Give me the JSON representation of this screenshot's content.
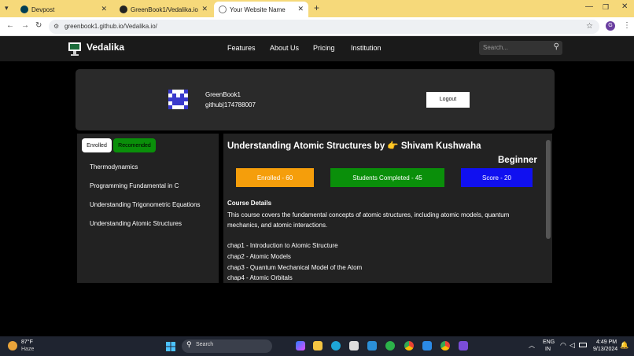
{
  "browser": {
    "tabs": [
      {
        "title": "Devpost"
      },
      {
        "title": "GreenBook1/Vedalika.io"
      },
      {
        "title": "Your Website Name"
      }
    ],
    "url": "greenbook1.github.io/Vedalika.io/",
    "profile_initial": "G"
  },
  "nav": {
    "brand": "Vedalika",
    "links": [
      "Features",
      "About Us",
      "Pricing",
      "Institution"
    ],
    "search_placeholder": "Search..."
  },
  "profile": {
    "name": "GreenBook1",
    "id": "github|174788007",
    "logout_label": "Logout"
  },
  "sidebar": {
    "tabs": [
      "Enrolled",
      "Recomended"
    ],
    "courses": [
      "Thermodynamics",
      "Programming Fundamental in C",
      "Understanding Trigonometric Equations",
      "Understanding Atomic Structures"
    ]
  },
  "course": {
    "title": "Understanding Atomic Structures by 👉 Shivam Kushwaha",
    "level": "Beginner",
    "stats": {
      "enrolled": "Enrolled - 60",
      "completed": "Students Completed - 45",
      "score": "Score - 20"
    },
    "details_heading": "Course Details",
    "description": "This course covers the fundamental concepts of atomic structures, including atomic models, quantum mechanics, and atomic interactions.",
    "chapters": [
      "chap1 - Introduction to Atomic Structure",
      "chap2 - Atomic Models",
      "chap3 - Quantum Mechanical Model of the Atom",
      "chap4 - Atomic Orbitals"
    ]
  },
  "taskbar": {
    "weather_temp": "87°F",
    "weather_desc": "Haze",
    "search_label": "Search",
    "lang1": "ENG",
    "lang2": "IN",
    "time": "4:49 PM",
    "date": "9/13/2024"
  },
  "colors": {
    "enrolled": "#f59e0b",
    "completed": "#0a8f0a",
    "score": "#1010f0",
    "recommended": "#0a8f0a"
  }
}
